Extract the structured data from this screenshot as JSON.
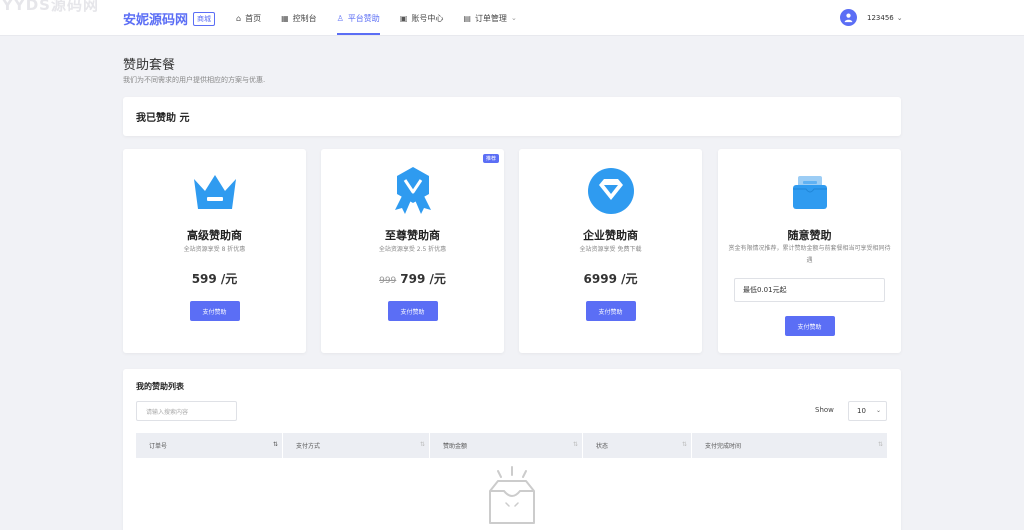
{
  "watermark": "YYDS源码网",
  "header": {
    "brand": "安妮源码网",
    "brand_tag": "商城",
    "nav": [
      {
        "label": "首页",
        "icon": "home-icon"
      },
      {
        "label": "控制台",
        "icon": "dashboard-icon"
      },
      {
        "label": "平台赞助",
        "icon": "sponsor-icon",
        "active": true
      },
      {
        "label": "账号中心",
        "icon": "account-icon"
      },
      {
        "label": "订单管理",
        "icon": "order-icon",
        "dropdown": true
      }
    ],
    "username": "123456"
  },
  "page": {
    "title": "赞助套餐",
    "subtitle": "我们为不同需求的用户提供相应的方案与优惠."
  },
  "sponsored": {
    "label": "我已赞助 元"
  },
  "plans": [
    {
      "title": "高级赞助商",
      "desc": "全站资源享受 8 折优惠",
      "price": "599 /元",
      "button": "支付赞助",
      "icon": "crown-icon"
    },
    {
      "title": "至尊赞助商",
      "desc": "全站资源享受 2.5 折优惠",
      "old_price": "999",
      "price": "799 /元",
      "button": "支付赞助",
      "badge": "推荐",
      "icon": "medal-icon"
    },
    {
      "title": "企业赞助商",
      "desc": "全站资源享受 免费下载",
      "price": "6999 /元",
      "button": "支付赞助",
      "icon": "diamond-icon"
    },
    {
      "title": "随意赞助",
      "desc": "赏金有限情况推荐，累计赞助金额与前套餐相当可享受相同待遇",
      "input_value": "最低0.01元起",
      "button": "支付赞助",
      "icon": "wallet-icon"
    }
  ],
  "list": {
    "title": "我的赞助列表",
    "search_placeholder": "请输入搜索内容",
    "show_label": "Show",
    "page_size": "10",
    "columns": [
      "订单号",
      "支付方式",
      "赞助金额",
      "状态",
      "支付完成时间"
    ]
  },
  "colors": {
    "accent": "#5b6ef5",
    "page_bg": "#f1f2f6"
  }
}
